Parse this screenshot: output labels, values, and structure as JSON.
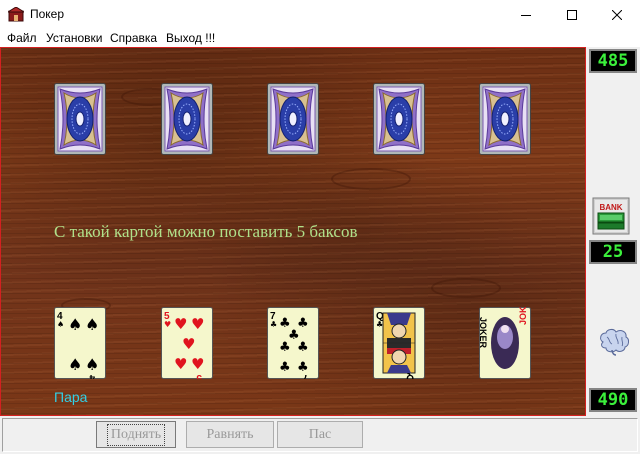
{
  "window": {
    "title": "Покер"
  },
  "menu": [
    "Файл",
    "Установки",
    "Справка",
    "Выход !!!"
  ],
  "table": {
    "message": "С такой картой можно поставить 5 баксов",
    "combination": "Пара"
  },
  "opponent_cards": [
    {
      "face": "down"
    },
    {
      "face": "down"
    },
    {
      "face": "down"
    },
    {
      "face": "down"
    },
    {
      "face": "down"
    }
  ],
  "player_cards": [
    {
      "rank": "4",
      "suit": "spades",
      "suit_glyph": "♠",
      "color": "#000000"
    },
    {
      "rank": "5",
      "suit": "hearts",
      "suit_glyph": "♥",
      "color": "#e0141e"
    },
    {
      "rank": "7",
      "suit": "clubs",
      "suit_glyph": "♣",
      "color": "#000000"
    },
    {
      "rank": "Q",
      "suit": "clubs",
      "suit_glyph": "♣",
      "color": "#000000"
    },
    {
      "rank": "JOKER",
      "suit": "joker",
      "suit_glyph": "",
      "color": "#e0141e"
    }
  ],
  "sidebar": {
    "opponent_money": "485",
    "bank_icon": "bank-icon",
    "bank_label": "BANK",
    "bank_amount": "25",
    "player_icon": "brain-icon",
    "player_money": "490"
  },
  "buttons": {
    "raise": "Поднять",
    "call": "Равнять",
    "pass": "Пас"
  },
  "colors": {
    "felt": "#7a3717",
    "table_border": "#d42020",
    "lcd_text": "#3bf03b",
    "message": "#b0e08a",
    "combination": "#31d0e6"
  }
}
